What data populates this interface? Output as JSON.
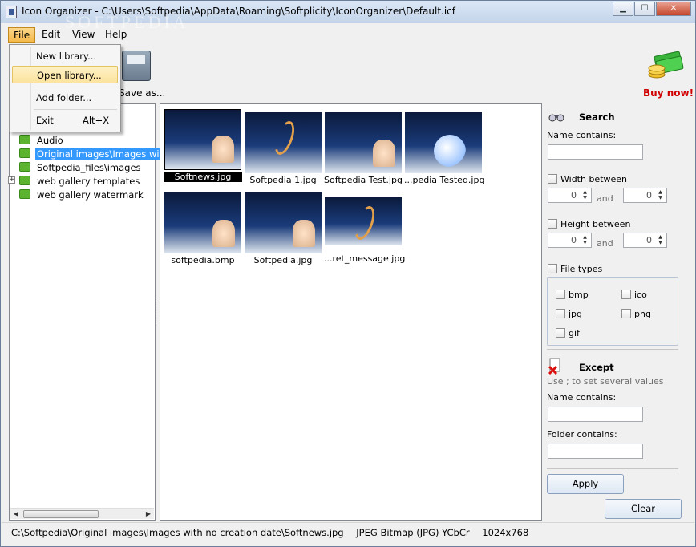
{
  "window": {
    "title": "Icon Organizer - C:\\Users\\Softpedia\\AppData\\Roaming\\Softplicity\\IconOrganizer\\Default.icf",
    "watermark": "SOFTPEDIA",
    "minimize": "▁",
    "maximize": "☐",
    "close": "✕"
  },
  "menubar": {
    "items": [
      "File",
      "Edit",
      "View",
      "Help"
    ],
    "active": "File"
  },
  "file_menu": {
    "items": [
      {
        "label": "New library...",
        "shortcut": ""
      },
      {
        "label": "Open library...",
        "shortcut": ""
      },
      {
        "label": "Add folder...",
        "shortcut": ""
      },
      {
        "label": "Exit",
        "shortcut": "Alt+X"
      }
    ],
    "hover_index": 1
  },
  "toolbar": {
    "save_as_label": "Save as...",
    "buy_now_label": "Buy now!",
    "buy_icon": "money-stack-icon"
  },
  "tree": {
    "items": [
      {
        "label": "Audio",
        "expandable": false,
        "selected": false
      },
      {
        "label": "Original images\\Images wit",
        "expandable": false,
        "selected": true
      },
      {
        "label": "Softpedia_files\\images",
        "expandable": false,
        "selected": false
      },
      {
        "label": "web gallery templates",
        "expandable": true,
        "selected": false
      },
      {
        "label": "web gallery watermark",
        "expandable": false,
        "selected": false
      }
    ],
    "folder_color": "#5bb330",
    "selected_color": "#3399ff"
  },
  "thumbnails": [
    {
      "caption": "Softnews.jpg",
      "selected": true,
      "style": "figure"
    },
    {
      "caption": "Softpedia 1.jpg",
      "selected": false,
      "style": "glow"
    },
    {
      "caption": "Softpedia Test.jpg",
      "selected": false,
      "style": "figure"
    },
    {
      "caption": "...pedia Tested.jpg",
      "selected": false,
      "style": "moon"
    },
    {
      "caption": "softpedia.bmp",
      "selected": false,
      "style": "figure"
    },
    {
      "caption": "Softpedia.jpg",
      "selected": false,
      "style": "figure"
    },
    {
      "caption": "...ret_message.jpg",
      "selected": false,
      "style": "glow"
    }
  ],
  "search": {
    "title": "Search",
    "name_contains_label": "Name contains:",
    "name_contains_value": "",
    "width_between_label": "Width between",
    "width_from": "0",
    "width_to": "0",
    "height_between_label": "Height between",
    "height_from": "0",
    "height_to": "0",
    "and_label": "and",
    "file_types_label": "File types",
    "file_types": [
      "bmp",
      "ico",
      "jpg",
      "png",
      "gif"
    ]
  },
  "except": {
    "title": "Except",
    "hint": "Use ; to set several values",
    "name_contains_label": "Name contains:",
    "name_contains_value": "",
    "folder_contains_label": "Folder contains:",
    "folder_contains_value": ""
  },
  "actions": {
    "apply": "Apply",
    "clear": "Clear"
  },
  "status": {
    "path": "C:\\Softpedia\\Original images\\Images with no creation date\\Softnews.jpg",
    "format": "JPEG Bitmap (JPG) YCbCr",
    "dimensions": "1024x768"
  }
}
